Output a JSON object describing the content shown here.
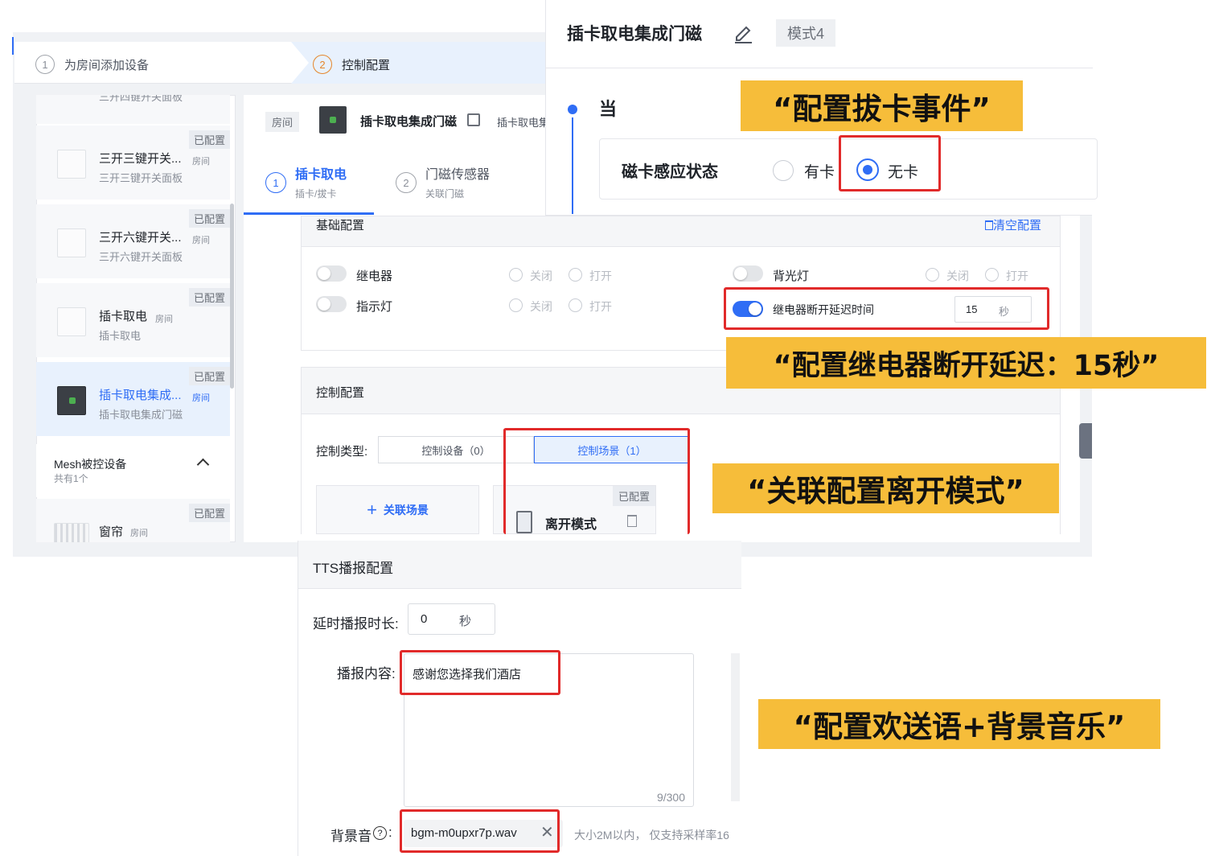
{
  "wizard": {
    "step1_num": "1",
    "step1_label": "为房间添加设备",
    "step2_num": "2",
    "step2_label": "控制配置"
  },
  "device_list": {
    "partial_top": "三开四键开关面板",
    "items": [
      {
        "badge": "已配置",
        "name": "三开三键开关...",
        "tag": "房间",
        "sub": "三开三键开关面板"
      },
      {
        "badge": "已配置",
        "name": "三开六键开关...",
        "tag": "房间",
        "sub": "三开六键开关面板"
      },
      {
        "badge": "已配置",
        "name": "插卡取电",
        "tag": "房间",
        "sub": "插卡取电"
      },
      {
        "badge": "已配置",
        "name": "插卡取电集成...",
        "tag": "房间",
        "sub": "插卡取电集成门磁"
      }
    ],
    "mesh_title": "Mesh被控设备",
    "mesh_count": "共有1个",
    "curtain": {
      "badge": "已配置",
      "name": "窗帘",
      "tag": "房间"
    }
  },
  "device_header": {
    "room": "房间",
    "name": "插卡取电集成门磁",
    "extra": "插卡取电集"
  },
  "sub_tabs": [
    {
      "num": "1",
      "title": "插卡取电",
      "sub": "插卡/拔卡"
    },
    {
      "num": "2",
      "title": "门磁传感器",
      "sub": "关联门磁"
    }
  ],
  "basic_config": {
    "title": "基础配置",
    "clear": "清空配置",
    "relay": "继电器",
    "indicator": "指示灯",
    "backlight": "背光灯",
    "off": "关闭",
    "on": "打开",
    "delay_label": "继电器断开延迟时间",
    "delay_value": "15",
    "delay_unit": "秒"
  },
  "control_config": {
    "title": "控制配置",
    "type_label": "控制类型:",
    "tab_device": "控制设备（0）",
    "tab_scene": "控制场景（1）",
    "add_scene": "关联场景",
    "scene_badge": "已配置",
    "scene_name": "离开模式"
  },
  "event_panel": {
    "title": "插卡取电集成门磁",
    "mode": "模式4",
    "when": "当",
    "card_label": "磁卡感应状态",
    "opt_has": "有卡",
    "opt_none": "无卡"
  },
  "tts": {
    "title": "TTS播报配置",
    "delay_label": "延时播报时长:",
    "delay_value": "0",
    "delay_unit": "秒",
    "content_label": "播报内容:",
    "content_value": "感谢您选择我们酒店",
    "counter": "9/300",
    "bgm_label": "背景音",
    "bgm_file": "bgm-m0upxr7p.wav",
    "bgm_hint": "大小2M以内， 仅支持采样率16"
  },
  "callouts": {
    "c1": "“配置拔卡事件”",
    "c2": "“配置继电器断开延迟：15秒”",
    "c3": "“关联配置离开模式”",
    "c4": "“配置欢送语+背景音乐”"
  },
  "colors": {
    "primary": "#2f6df5",
    "callout": "#f6bd3a",
    "highlight": "#e12a2a"
  }
}
